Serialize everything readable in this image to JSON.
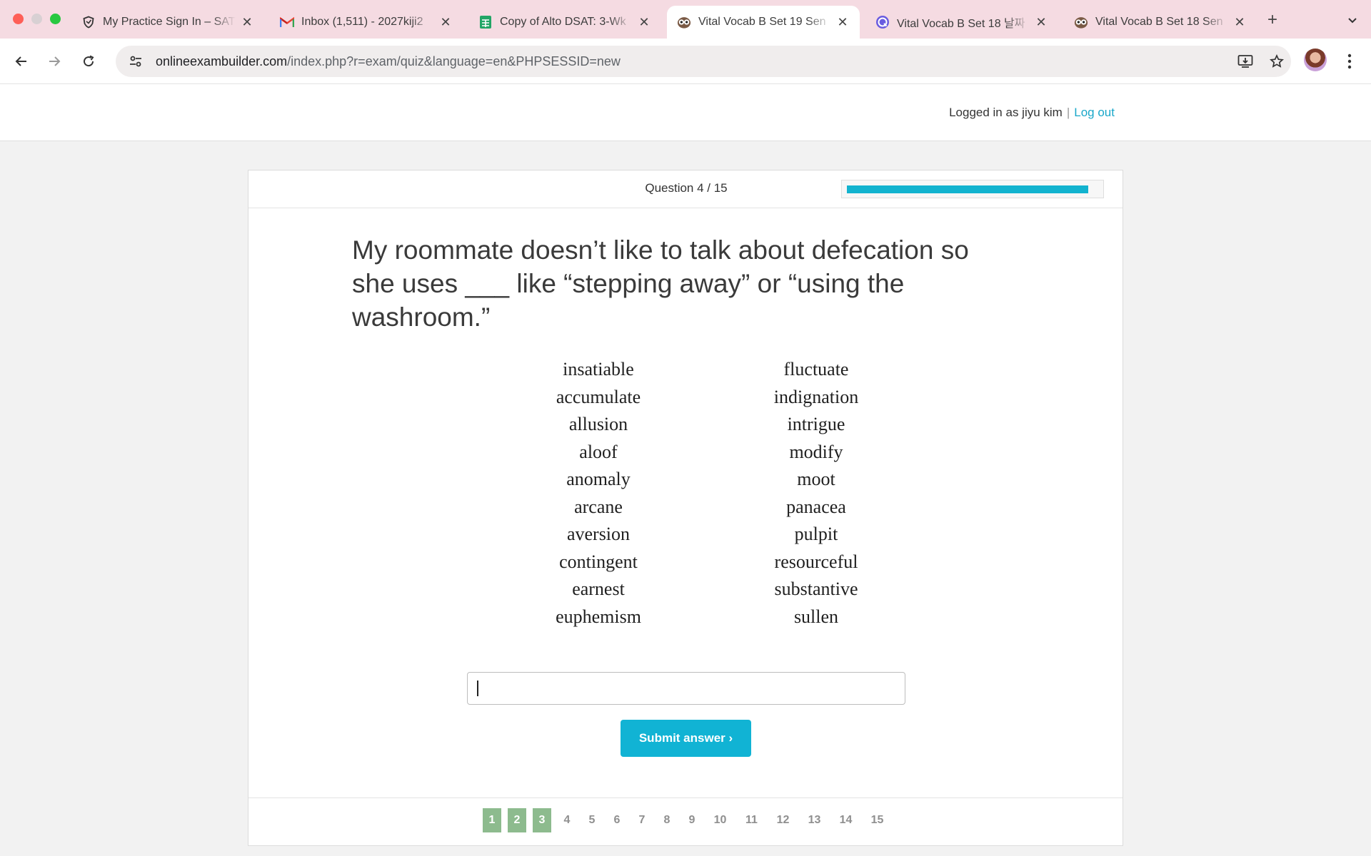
{
  "browser": {
    "tabs": [
      {
        "title": "My Practice Sign In – SAT",
        "icon": "shield-icon",
        "active": false
      },
      {
        "title": "Inbox (1,511) - 2027kiji2",
        "icon": "gmail-icon",
        "active": false
      },
      {
        "title": "Copy of Alto DSAT: 3-Wk",
        "icon": "sheets-icon",
        "active": false
      },
      {
        "title": "Vital Vocab B Set 19 Sen",
        "icon": "owl-icon",
        "active": true
      },
      {
        "title": "Vital Vocab B Set 18 날짜",
        "icon": "quizlet-icon",
        "active": false
      },
      {
        "title": "Vital Vocab B Set 18 Sen",
        "icon": "owl-icon",
        "active": false
      }
    ],
    "url_main": "onlineexambuilder.com",
    "url_rest": "/index.php?r=exam/quiz&language=en&PHPSESSID=new"
  },
  "header": {
    "logged_in_text": "Logged in as jiyu kim",
    "separator": "|",
    "logout_label": "Log out"
  },
  "quiz": {
    "counter": "Question 4 / 15",
    "progress_fraction": 0.96,
    "accent_color": "#12b3cf",
    "question": "My roommate doesn’t like to talk about defecation so she uses ___ like “stepping away” or “using the washroom.”",
    "word_bank_left": [
      "insatiable",
      "accumulate",
      "allusion",
      "aloof",
      "anomaly",
      "arcane",
      "aversion",
      "contingent",
      "earnest",
      "euphemism"
    ],
    "word_bank_right": [
      "fluctuate",
      "indignation",
      "intrigue",
      "modify",
      "moot",
      "panacea",
      "pulpit",
      "resourceful",
      "substantive",
      "sullen"
    ],
    "answer_value": "",
    "submit_label": "Submit answer ›",
    "pages": [
      {
        "label": "1",
        "answered": true
      },
      {
        "label": "2",
        "answered": true
      },
      {
        "label": "3",
        "answered": true
      },
      {
        "label": "4",
        "answered": false
      },
      {
        "label": "5",
        "answered": false
      },
      {
        "label": "6",
        "answered": false
      },
      {
        "label": "7",
        "answered": false
      },
      {
        "label": "8",
        "answered": false
      },
      {
        "label": "9",
        "answered": false
      },
      {
        "label": "10",
        "answered": false
      },
      {
        "label": "11",
        "answered": false
      },
      {
        "label": "12",
        "answered": false
      },
      {
        "label": "13",
        "answered": false
      },
      {
        "label": "14",
        "answered": false
      },
      {
        "label": "15",
        "answered": false
      }
    ],
    "answered_color": "#8dbb8e"
  }
}
